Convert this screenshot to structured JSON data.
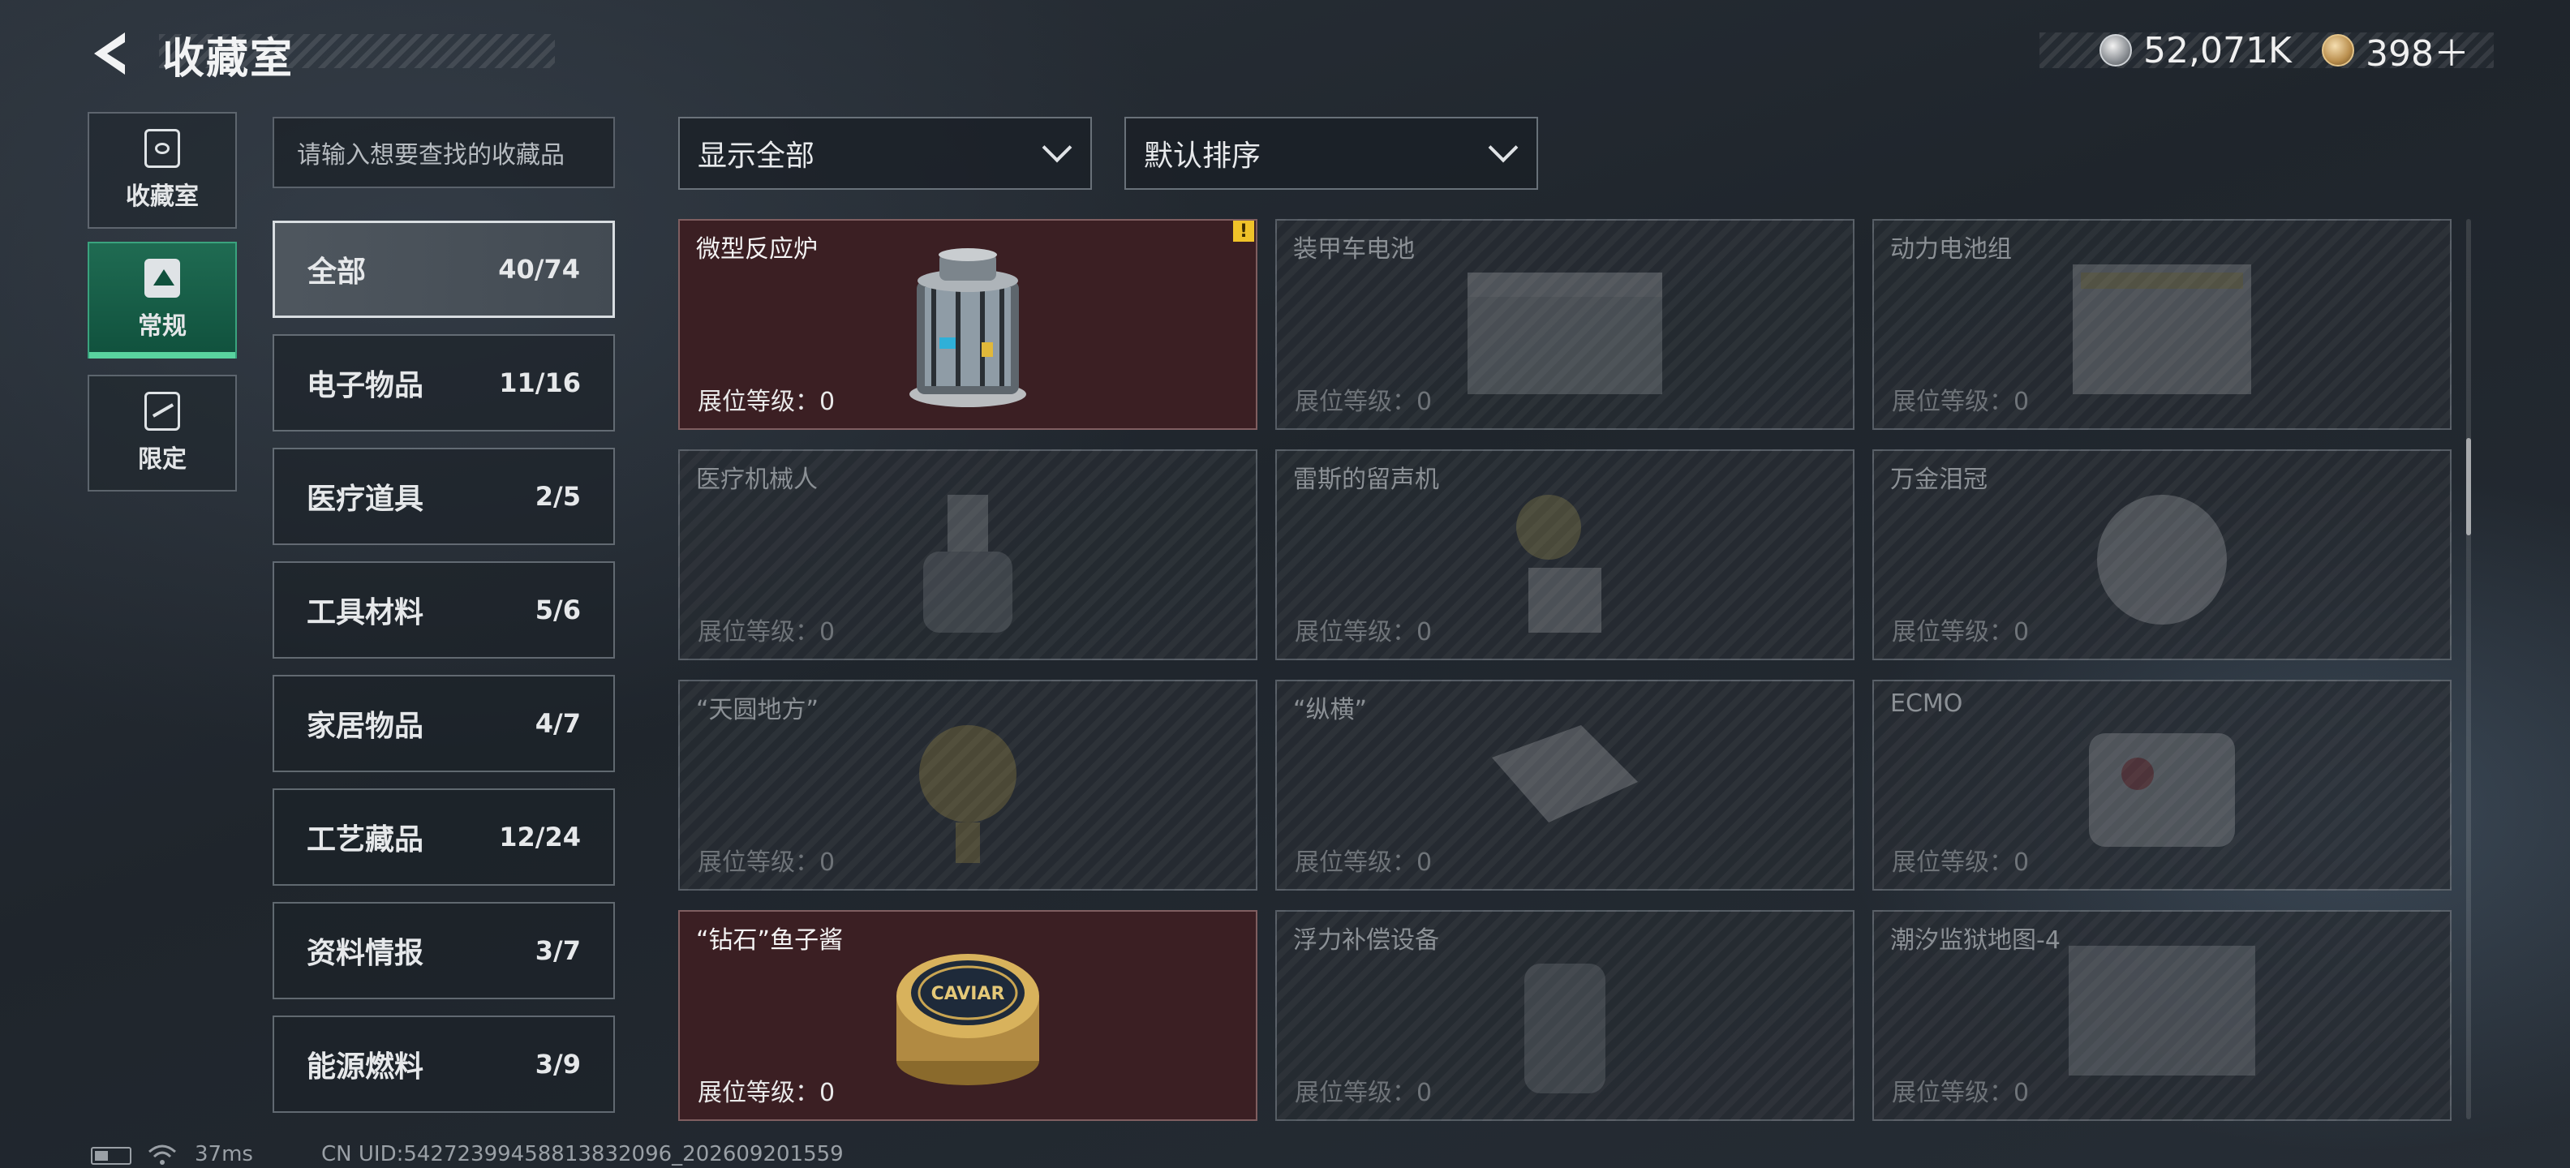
{
  "header": {
    "title": "收藏室",
    "currency_silver": "52,071K",
    "currency_gold": "398＋"
  },
  "side_tabs": [
    {
      "label": "收藏室",
      "icon": "collection-room-icon"
    },
    {
      "label": "常规",
      "icon": "regular-items-icon",
      "active": true
    },
    {
      "label": "限定",
      "icon": "limited-items-icon"
    }
  ],
  "search": {
    "placeholder": "请输入想要查找的收藏品"
  },
  "categories": [
    {
      "label": "全部",
      "count": "40/74",
      "active": true
    },
    {
      "label": "电子物品",
      "count": "11/16"
    },
    {
      "label": "医疗道具",
      "count": "2/5"
    },
    {
      "label": "工具材料",
      "count": "5/6"
    },
    {
      "label": "家居物品",
      "count": "4/7"
    },
    {
      "label": "工艺藏品",
      "count": "12/24"
    },
    {
      "label": "资料情报",
      "count": "3/7"
    },
    {
      "label": "能源燃料",
      "count": "3/9"
    }
  ],
  "filters": {
    "display": "显示全部",
    "sort": "默认排序"
  },
  "items": [
    {
      "name": "微型反应炉",
      "level": "展位等级：0",
      "owned": true,
      "warning": true,
      "icon": "micro-reactor-icon"
    },
    {
      "name": "装甲车电池",
      "level": "展位等级：0",
      "owned": false,
      "icon": "armored-battery-icon"
    },
    {
      "name": "动力电池组",
      "level": "展位等级：0",
      "owned": false,
      "icon": "power-battery-pack-icon"
    },
    {
      "name": "医疗机械人",
      "level": "展位等级：0",
      "owned": false,
      "icon": "medical-robot-icon"
    },
    {
      "name": "雷斯的留声机",
      "level": "展位等级：0",
      "owned": false,
      "icon": "gramophone-icon"
    },
    {
      "name": "万金泪冠",
      "level": "展位等级：0",
      "owned": false,
      "icon": "crown-icon"
    },
    {
      "name": "“天圆地方”",
      "level": "展位等级：0",
      "owned": false,
      "icon": "globe-icon"
    },
    {
      "name": "“纵横”",
      "level": "展位等级：0",
      "owned": false,
      "icon": "chessboard-icon"
    },
    {
      "name": "ECMO",
      "level": "展位等级：0",
      "owned": false,
      "icon": "ecmo-icon"
    },
    {
      "name": "“钻石”鱼子酱",
      "level": "展位等级：0",
      "owned": true,
      "icon": "caviar-tin-icon",
      "art_label": "CAVIAR"
    },
    {
      "name": "浮力补偿设备",
      "level": "展位等级：0",
      "owned": false,
      "icon": "buoyancy-device-icon"
    },
    {
      "name": "潮汐监狱地图-4",
      "level": "展位等级：0",
      "owned": false,
      "icon": "map-icon"
    }
  ],
  "status_bar": {
    "ping": "37ms",
    "uid": "CN UID:54272399458813832096_202609201559"
  },
  "colors": {
    "owned_card": "#3b1f23",
    "active_tab": "#1f6b52",
    "warning": "#f0c229"
  }
}
